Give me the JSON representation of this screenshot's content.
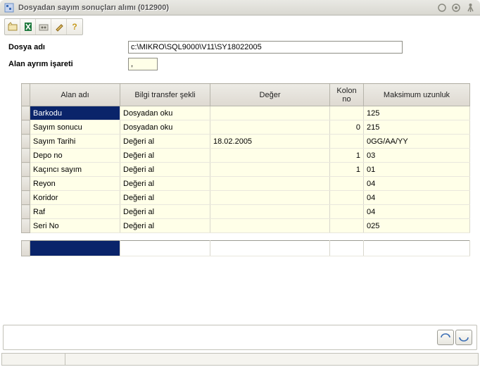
{
  "window": {
    "title": "Dosyadan sayım sonuçları alımı (012900)"
  },
  "form": {
    "file_label": "Dosya adı",
    "file_value": "c:\\MIKRO\\SQL9000\\V11\\SY18022005",
    "sep_label": "Alan ayrım işareti",
    "sep_value": ","
  },
  "grid": {
    "headers": {
      "col1": "Alan adı",
      "col2": "Bilgi transfer şekli",
      "col3": "Değer",
      "col4": "Kolon no",
      "col5": "Maksimum uzunluk"
    },
    "rows": [
      {
        "alan": "Barkodu",
        "transfer": "Dosyadan oku",
        "deger": "",
        "kolon": "",
        "max": "125"
      },
      {
        "alan": "Sayım sonucu",
        "transfer": "Dosyadan oku",
        "deger": "",
        "kolon": "0",
        "max": "215"
      },
      {
        "alan": "Sayım Tarihi",
        "transfer": "Değeri al",
        "deger": "18.02.2005",
        "kolon": "",
        "max": "0GG/AA/YY"
      },
      {
        "alan": "Depo no",
        "transfer": "Değeri al",
        "deger": "",
        "kolon": "1",
        "max": "03"
      },
      {
        "alan": "Kaçıncı sayım",
        "transfer": "Değeri al",
        "deger": "",
        "kolon": "1",
        "max": "01"
      },
      {
        "alan": "Reyon",
        "transfer": "Değeri al",
        "deger": "",
        "kolon": "",
        "max": "04"
      },
      {
        "alan": "Koridor",
        "transfer": "Değeri al",
        "deger": "",
        "kolon": "",
        "max": "04"
      },
      {
        "alan": "Raf",
        "transfer": "Değeri al",
        "deger": "",
        "kolon": "",
        "max": "04"
      },
      {
        "alan": "Seri No",
        "transfer": "Değeri al",
        "deger": "",
        "kolon": "",
        "max": "025"
      }
    ]
  }
}
